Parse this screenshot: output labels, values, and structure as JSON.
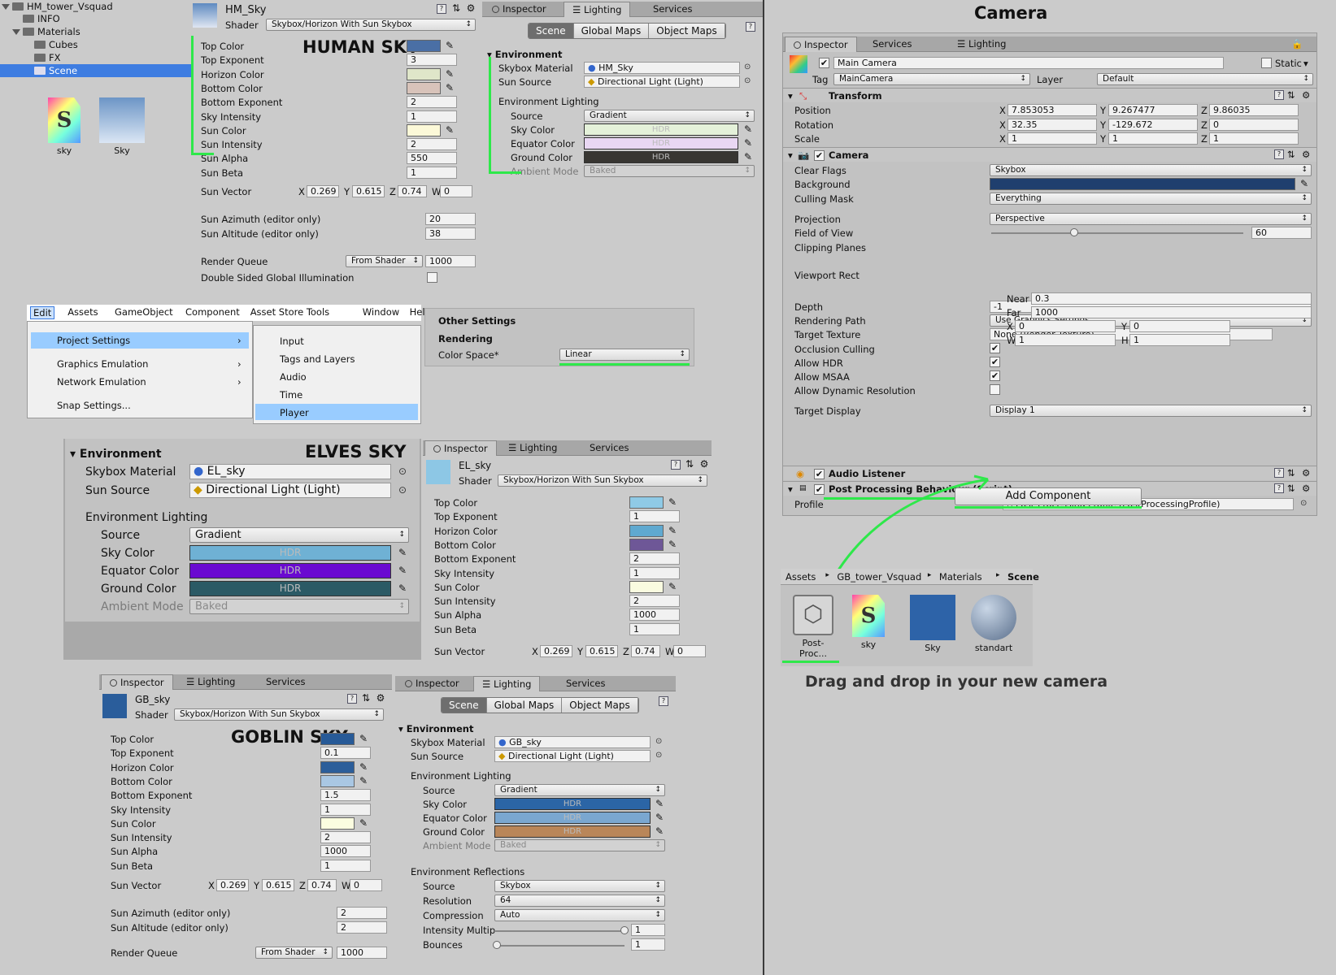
{
  "tree": {
    "root": "HM_tower_Vsquad",
    "info": "INFO",
    "materials": "Materials",
    "cubes": "Cubes",
    "fx": "FX",
    "scene": "Scene"
  },
  "assets_left": [
    {
      "label": "sky",
      "letter": "S"
    },
    {
      "label": "Sky"
    }
  ],
  "human": {
    "title": "HUMAN SKY",
    "material": "HM_Sky",
    "shader_label": "Shader",
    "shader": "Skybox/Horizon With Sun Skybox",
    "props": [
      {
        "label": "Top Color",
        "type": "color",
        "color": "#4a6fa5"
      },
      {
        "label": "Top Exponent",
        "type": "num",
        "value": "3"
      },
      {
        "label": "Horizon Color",
        "type": "color",
        "color": "#dfe6c9"
      },
      {
        "label": "Bottom Color",
        "type": "color",
        "color": "#d8c3ba"
      },
      {
        "label": "Bottom Exponent",
        "type": "num",
        "value": "2"
      },
      {
        "label": "Sky Intensity",
        "type": "num",
        "value": "1"
      },
      {
        "label": "Sun Color",
        "type": "color",
        "color": "#fcf9d8"
      },
      {
        "label": "Sun Intensity",
        "type": "num",
        "value": "2"
      },
      {
        "label": "Sun Alpha",
        "type": "num",
        "value": "550"
      },
      {
        "label": "Sun Beta",
        "type": "num",
        "value": "1"
      }
    ],
    "sun_vector": {
      "label": "Sun Vector",
      "x": "0.269",
      "y": "0.615",
      "z": "0.74",
      "w": "0"
    },
    "azimuth": {
      "label": "Sun Azimuth (editor only)",
      "value": "20"
    },
    "altitude": {
      "label": "Sun Altitude (editor only)",
      "value": "38"
    },
    "render_queue": {
      "label": "Render Queue",
      "mode": "From Shader",
      "value": "1000"
    },
    "dsgi": "Double Sided Global Illumination"
  },
  "lighting_tabs": {
    "inspector": "Inspector",
    "lighting": "Lighting",
    "services": "Services",
    "scene": "Scene",
    "global_maps": "Global Maps",
    "object_maps": "Object Maps"
  },
  "env_labels": {
    "environment": "Environment",
    "skybox_material": "Skybox Material",
    "sun_source": "Sun Source",
    "env_lighting": "Environment Lighting",
    "source": "Source",
    "sky_color": "Sky Color",
    "equator_color": "Equator Color",
    "ground_color": "Ground Color",
    "ambient_mode": "Ambient Mode",
    "hdr": "HDR",
    "gradient": "Gradient",
    "baked": "Baked",
    "directional": "Directional Light (Light)"
  },
  "human_env": {
    "skybox": "HM_Sky",
    "sky": "#e4f1d9",
    "equator": "#e9d7f3",
    "ground": "#383632"
  },
  "menu": {
    "bar": [
      "Edit",
      "Assets",
      "GameObject",
      "Component",
      "Asset Store Tools",
      "Window",
      "Help"
    ],
    "items": [
      "Project Settings",
      "Graphics Emulation",
      "Network Emulation",
      "Snap Settings..."
    ],
    "sub": [
      "Input",
      "Tags and Layers",
      "Audio",
      "Time",
      "Player"
    ]
  },
  "other_settings": {
    "title": "Other Settings",
    "rendering": "Rendering",
    "color_space_label": "Color Space*",
    "color_space": "Linear"
  },
  "elves": {
    "title": "ELVES SKY",
    "skybox": "EL_sky",
    "sky": "#6fb1d4",
    "equator": "#6a0ad1",
    "ground": "#2b5a65",
    "material": "EL_sky",
    "shader": "Skybox/Horizon With Sun Skybox",
    "props": [
      {
        "label": "Top Color",
        "type": "color",
        "color": "#8fcae6"
      },
      {
        "label": "Top Exponent",
        "type": "num",
        "value": "1"
      },
      {
        "label": "Horizon Color",
        "type": "color",
        "color": "#5fa9d0"
      },
      {
        "label": "Bottom Color",
        "type": "color",
        "color": "#6e5797"
      },
      {
        "label": "Bottom Exponent",
        "type": "num",
        "value": "2"
      },
      {
        "label": "Sky Intensity",
        "type": "num",
        "value": "1"
      },
      {
        "label": "Sun Color",
        "type": "color",
        "color": "#f9fbe0"
      },
      {
        "label": "Sun Intensity",
        "type": "num",
        "value": "2"
      },
      {
        "label": "Sun Alpha",
        "type": "num",
        "value": "1000"
      },
      {
        "label": "Sun Beta",
        "type": "num",
        "value": "1"
      }
    ],
    "sun_vector": {
      "label": "Sun Vector",
      "x": "0.269",
      "y": "0.615",
      "z": "0.74",
      "w": "0"
    }
  },
  "goblin": {
    "title": "GOBLIN SKY",
    "material": "GB_sky",
    "shader": "Skybox/Horizon With Sun Skybox",
    "props": [
      {
        "label": "Top Color",
        "type": "color",
        "color": "#275a97"
      },
      {
        "label": "Top Exponent",
        "type": "num",
        "value": "0.1"
      },
      {
        "label": "Horizon Color",
        "type": "color",
        "color": "#2c5e9a"
      },
      {
        "label": "Bottom Color",
        "type": "color",
        "color": "#a9c7e3"
      },
      {
        "label": "Bottom Exponent",
        "type": "num",
        "value": "1.5"
      },
      {
        "label": "Sky Intensity",
        "type": "num",
        "value": "1"
      },
      {
        "label": "Sun Color",
        "type": "color",
        "color": "#fbfde0"
      },
      {
        "label": "Sun Intensity",
        "type": "num",
        "value": "2"
      },
      {
        "label": "Sun Alpha",
        "type": "num",
        "value": "1000"
      },
      {
        "label": "Sun Beta",
        "type": "num",
        "value": "1"
      }
    ],
    "sun_vector": {
      "label": "Sun Vector",
      "x": "0.269",
      "y": "0.615",
      "z": "0.74",
      "w": "0"
    },
    "azimuth": {
      "label": "Sun Azimuth (editor only)",
      "value": "2"
    },
    "altitude": {
      "label": "Sun Altitude (editor only)",
      "value": "2"
    },
    "render_queue": {
      "label": "Render Queue",
      "mode": "From Shader",
      "value": "1000"
    },
    "env": {
      "skybox": "GB_sky",
      "sky": "#2b65a6",
      "equator": "#7aa7d0",
      "ground": "#b98659"
    },
    "reflections": {
      "title": "Environment Reflections",
      "source_label": "Source",
      "source": "Skybox",
      "resolution_label": "Resolution",
      "resolution": "64",
      "compression_label": "Compression",
      "compression": "Auto",
      "intensity_label": "Intensity Multip",
      "intensity": "1",
      "bounces_label": "Bounces",
      "bounces": "1"
    }
  },
  "camera": {
    "title": "Camera",
    "tabs": {
      "inspector": "Inspector",
      "services": "Services",
      "lighting": "Lighting"
    },
    "name": "Main Camera",
    "static": "Static",
    "tag_label": "Tag",
    "tag": "MainCamera",
    "layer_label": "Layer",
    "layer": "Default",
    "transform": {
      "title": "Transform",
      "position": [
        "7.853053",
        "9.267477",
        "9.86035"
      ],
      "rotation": [
        "32.35",
        "-129.672",
        "0"
      ],
      "scale": [
        "1",
        "1",
        "1"
      ],
      "labels": [
        "Position",
        "Rotation",
        "Scale"
      ]
    },
    "cam": {
      "title": "Camera",
      "rows": [
        {
          "label": "Clear Flags",
          "kind": "dd",
          "value": "Skybox"
        },
        {
          "label": "Background",
          "kind": "color",
          "value": "#1f3f6e"
        },
        {
          "label": "Culling Mask",
          "kind": "dd",
          "value": "Everything"
        },
        {
          "label": "Projection",
          "kind": "dd",
          "value": "Perspective"
        },
        {
          "label": "Field of View",
          "kind": "slider",
          "value": "60"
        },
        {
          "label": "Clipping Planes",
          "kind": "text",
          "value": ""
        },
        {
          "label": "Viewport Rect",
          "kind": "text",
          "value": ""
        },
        {
          "label": "Depth",
          "kind": "field",
          "value": "-1"
        },
        {
          "label": "Rendering Path",
          "kind": "dd",
          "value": "Use Graphics Settings"
        },
        {
          "label": "Target Texture",
          "kind": "field",
          "value": "None (Render Texture)"
        },
        {
          "label": "Occlusion Culling",
          "kind": "check",
          "value": "✔"
        },
        {
          "label": "Allow HDR",
          "kind": "check",
          "value": "✔"
        },
        {
          "label": "Allow MSAA",
          "kind": "check",
          "value": "✔"
        },
        {
          "label": "Allow Dynamic Resolution",
          "kind": "check",
          "value": ""
        },
        {
          "label": "Target Display",
          "kind": "dd",
          "value": "Display 1"
        }
      ],
      "near_label": "Near",
      "near": "0.3",
      "far_label": "Far",
      "far": "1000",
      "viewport": {
        "x": "0",
        "y": "0",
        "w": "1",
        "h": "1"
      }
    },
    "audio_listener": "Audio Listener",
    "ppb": {
      "title": "Post Processing Behaviour (Script)",
      "profile_label": "Profile",
      "profile": "Post-Processing Profile (PostProcessingProfile)"
    },
    "add_component": "Add Component"
  },
  "project": {
    "breadcrumb": [
      "Assets",
      "GB_tower_Vsquad",
      "Materials",
      "Scene"
    ],
    "items": [
      "Post-Proc...",
      "sky",
      "Sky",
      "standart"
    ],
    "caption": "Drag and drop in your new camera"
  }
}
